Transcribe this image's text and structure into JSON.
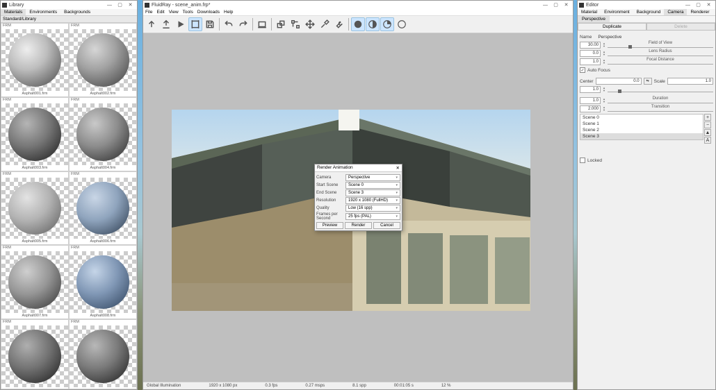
{
  "library": {
    "title": "Library",
    "tabs": [
      "Materials",
      "Environments",
      "Backgrounds"
    ],
    "activeTabIdx": 0,
    "sublabel": "Standard/Library",
    "items": [
      {
        "badge": "FRM",
        "caption": "Asphalt001.frm",
        "sphere": "radial-gradient(circle at 35% 30%,#EEE,#BDBDBD 40%,#777 75%,#444)"
      },
      {
        "badge": "FRM",
        "caption": "Asphalt002.frm",
        "sphere": "radial-gradient(circle at 35% 30%,#D6D6D6,#A2A2A2 40%,#666 75%,#333)"
      },
      {
        "badge": "FRM",
        "caption": "Asphalt003.frm",
        "sphere": "radial-gradient(circle at 35% 30%,#B5B5B5,#777 45%,#3A3A3A 80%,#111)"
      },
      {
        "badge": "FRM",
        "caption": "Asphalt004.frm",
        "sphere": "radial-gradient(circle at 35% 30%,#C9C9C9,#8C8C8C 45%,#4A4A4A 80%,#1C1C1C)"
      },
      {
        "badge": "FRM",
        "caption": "Asphalt005.frm",
        "sphere": "radial-gradient(circle at 35% 30%,#E3E3E3,#B3B3B3 45%,#7A7A7A 80%,#4D4D4D)"
      },
      {
        "badge": "FRM",
        "caption": "Asphalt006.frm",
        "sphere": "radial-gradient(circle at 35% 30%,#C9D6E6,#8FA4BD 45%,#4D5E73 80%,#23303E)"
      },
      {
        "badge": "FRM",
        "caption": "Asphalt007.frm",
        "sphere": "radial-gradient(circle at 35% 30%,#CFCFCF,#969696 45%,#555 80%,#222)"
      },
      {
        "badge": "FRM",
        "caption": "Asphalt008.frm",
        "sphere": "radial-gradient(circle at 35% 30%,#C5D5E8,#8097B5 45%,#4A5F7A 80%,#1F2E3E)"
      },
      {
        "badge": "FRM",
        "caption": "",
        "sphere": "radial-gradient(circle at 35% 30%,#AFAFAF,#737373 45%,#3A3A3A 80%,#0F0F0F)"
      },
      {
        "badge": "FRM",
        "caption": "",
        "sphere": "radial-gradient(circle at 35% 30%,#B8B8B8,#7A7A7A 45%,#3D3D3D 80%,#121212)"
      }
    ]
  },
  "main": {
    "title": "FluidRay - scene_anim.frp*",
    "menu": [
      "File",
      "Edit",
      "View",
      "Tools",
      "Downloads",
      "Help"
    ],
    "status": {
      "gi": "Global Illumination",
      "res": "1920 x 1080 px",
      "fps": "0.3 fps",
      "msps": "0.27 msps",
      "spp": "8.1 spp",
      "time": "00:01:05 s",
      "pct": "12 %"
    }
  },
  "editor": {
    "title": "Editor",
    "tabs": [
      "Material",
      "Environment",
      "Background",
      "Camera",
      "Renderer"
    ],
    "activeTabIdx": 3,
    "subvalue": "Perspective",
    "duplicate": "Duplicate",
    "delete": "Delete",
    "name_label": "Name",
    "name_value": "Perspective",
    "fov_label": "Field of View",
    "fov": "30.00",
    "lensradius_label": "Lens Radius",
    "lensradius": "0.0",
    "focal_label": "Focal Distance",
    "focal": "1.0",
    "autofocus_label": "Auto Focus",
    "center_label": "Center",
    "center_val": "0.0",
    "scale_label": "Scale",
    "scale_val": "1.0",
    "scale_slider": "1.0",
    "duration_label": "Duration",
    "duration": "1.0",
    "transition_label": "Transition",
    "transition": "2.000",
    "scenes": [
      "Scene 0",
      "Scene 1",
      "Scene 2",
      "Scene 3"
    ],
    "scene_sel": 3,
    "locked_label": "Locked"
  },
  "dialog": {
    "title": "Render Animation",
    "rows": [
      {
        "l": "Camera",
        "v": "Perspective"
      },
      {
        "l": "Start Scene",
        "v": "Scene 0"
      },
      {
        "l": "End Scene",
        "v": "Scene 3"
      },
      {
        "l": "Resolution",
        "v": "1920 x 1080 (FullHD)"
      },
      {
        "l": "Quality",
        "v": "Low (16 spp)"
      },
      {
        "l": "Frames per Second",
        "v": "25 fps (PAL)"
      }
    ],
    "buttons": [
      "Preview",
      "Render",
      "Cancel"
    ]
  },
  "winbtns": {
    "min": "—",
    "max": "▢",
    "close": "✕"
  }
}
